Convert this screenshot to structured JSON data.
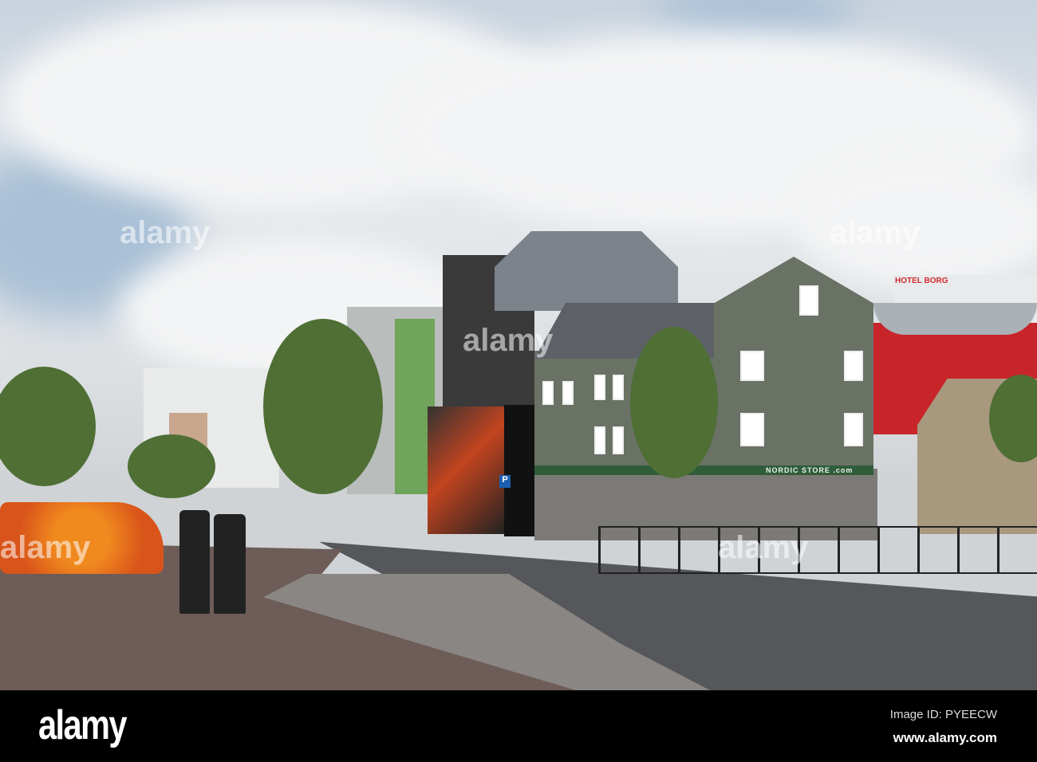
{
  "watermark": {
    "logo": "alamy",
    "image_id": "Image ID: PYEECW",
    "site": "www.alamy.com"
  },
  "scene_signs": {
    "hotel": "HOTEL BORG",
    "store": "NORDIC STORE .com",
    "parking": "P"
  },
  "colors": {
    "sky": "#dfe3e7",
    "red_building": "#c8252a",
    "green_building": "#6a7266",
    "road": "#4d4f52",
    "pavement": "#6e5c58",
    "flowers": "#e8751c"
  }
}
